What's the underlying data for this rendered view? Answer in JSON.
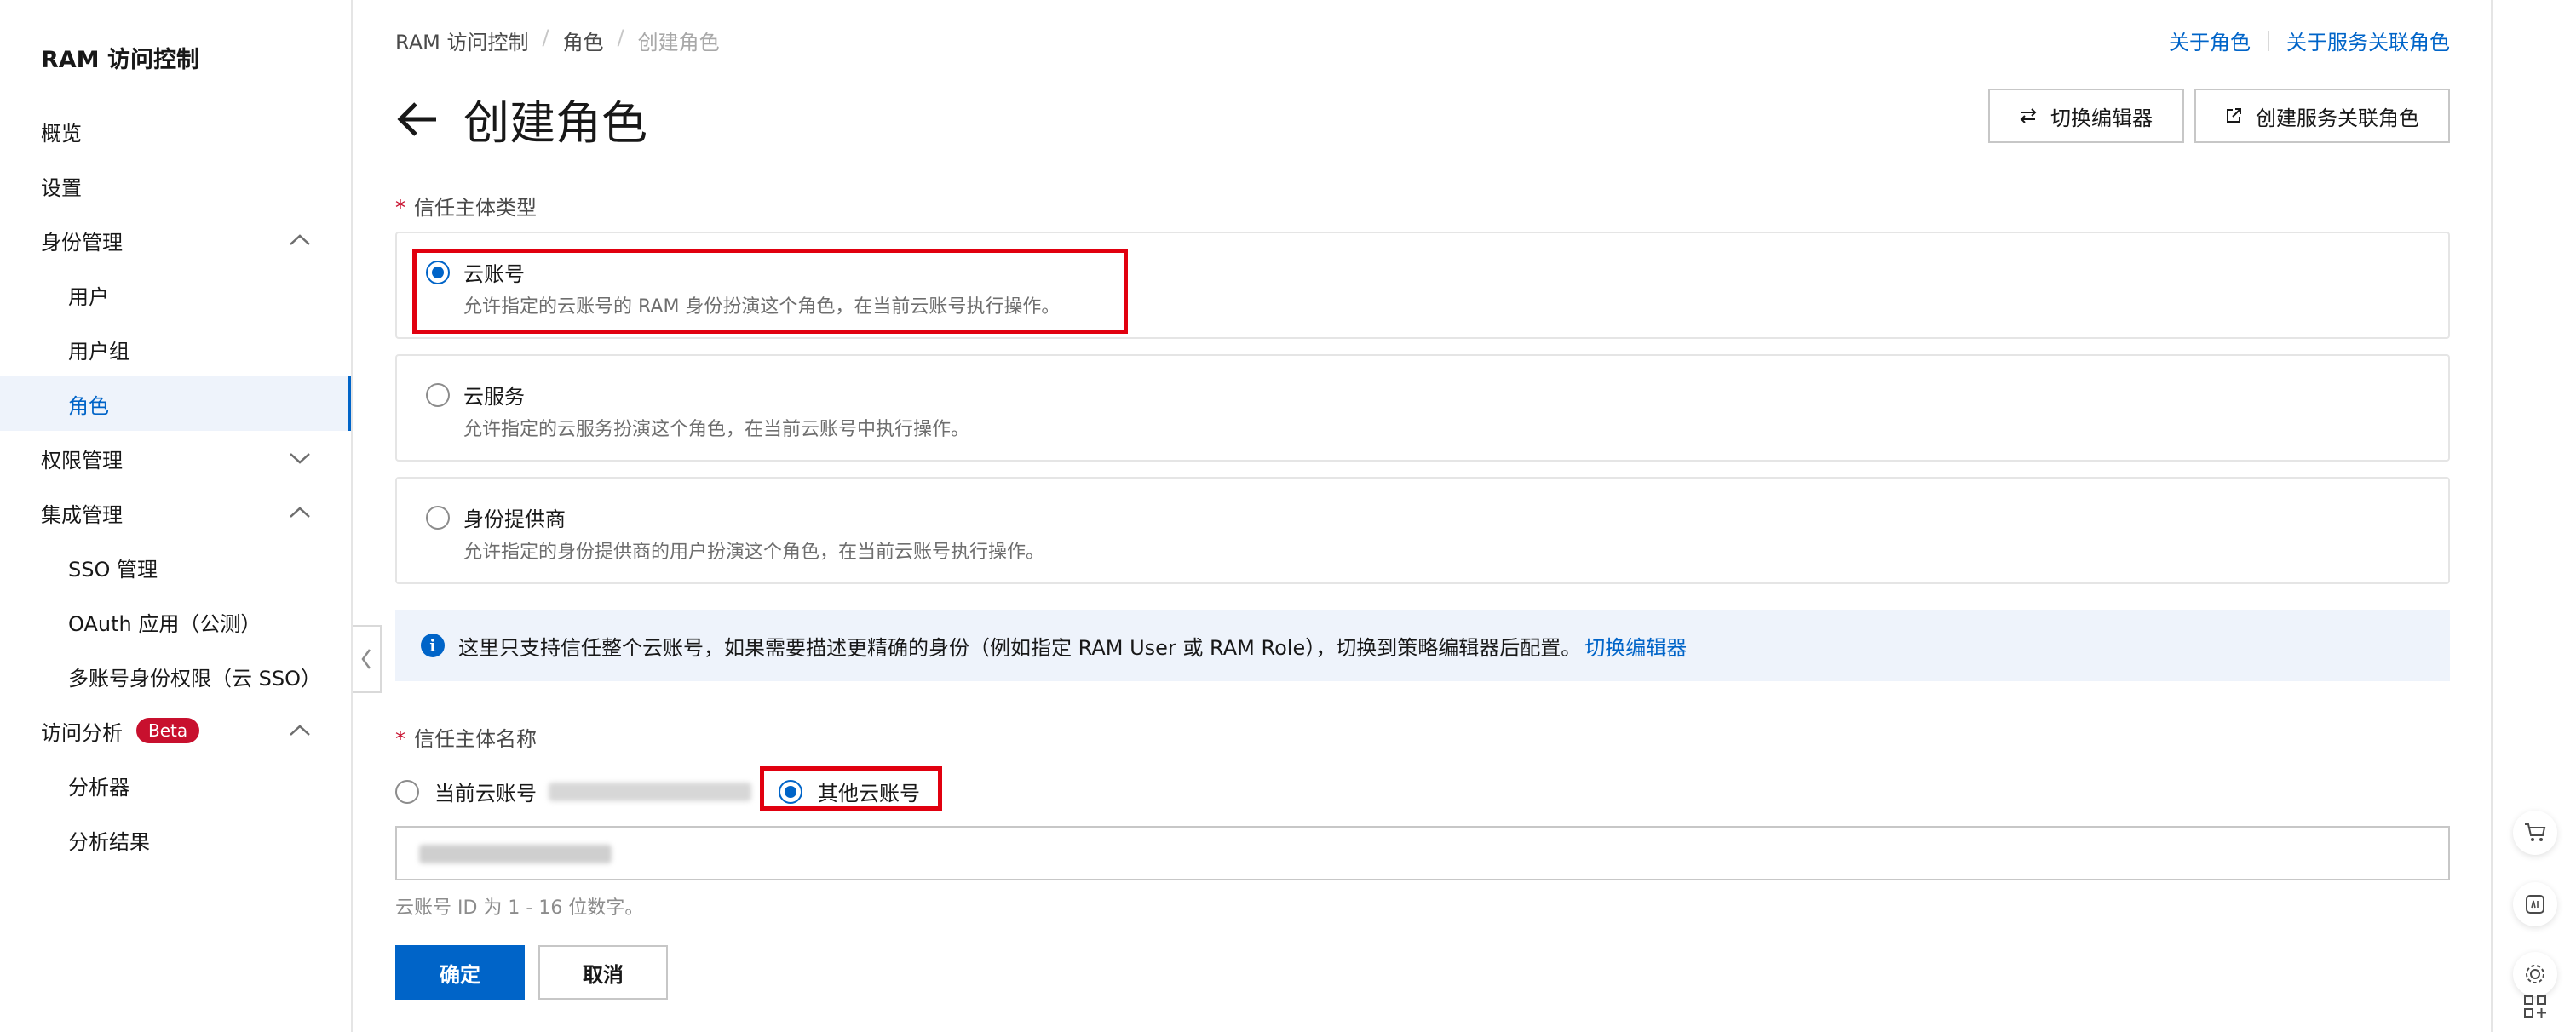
{
  "sidebar": {
    "title": "RAM 访问控制",
    "items": [
      {
        "label": "概览"
      },
      {
        "label": "设置"
      },
      {
        "label": "身份管理"
      },
      {
        "label": "用户"
      },
      {
        "label": "用户组"
      },
      {
        "label": "角色"
      },
      {
        "label": "权限管理"
      },
      {
        "label": "集成管理"
      },
      {
        "label": "SSO 管理"
      },
      {
        "label": "OAuth 应用（公测）"
      },
      {
        "label": "多账号身份权限（云 SSO）"
      },
      {
        "label": "访问分析",
        "badge": "Beta"
      },
      {
        "label": "分析器"
      },
      {
        "label": "分析结果"
      }
    ]
  },
  "breadcrumb": [
    "RAM 访问控制",
    "角色",
    "创建角色"
  ],
  "breadcrumb_sep": "/",
  "top_links": {
    "about_role": "关于角色",
    "about_service_role": "关于服务关联角色"
  },
  "page_title": "创建角色",
  "buttons": {
    "switch_editor": "切换编辑器",
    "create_service_role": "创建服务关联角色",
    "confirm": "确定",
    "cancel": "取消"
  },
  "trust_type": {
    "label": "信任主体类型",
    "required_mark": "*",
    "options": [
      {
        "title": "云账号",
        "desc": "允许指定的云账号的 RAM 身份扮演这个角色，在当前云账号执行操作。",
        "selected": true
      },
      {
        "title": "云服务",
        "desc": "允许指定的云服务扮演这个角色，在当前云账号中执行操作。",
        "selected": false
      },
      {
        "title": "身份提供商",
        "desc": "允许指定的身份提供商的用户扮演这个角色，在当前云账号执行操作。",
        "selected": false
      }
    ]
  },
  "info": {
    "text": "这里只支持信任整个云账号，如果需要描述更精确的身份（例如指定 RAM User 或 RAM Role），切换到策略编辑器后配置。",
    "link": "切换编辑器"
  },
  "trust_name": {
    "label": "信任主体名称",
    "required_mark": "*",
    "current_account": "当前云账号",
    "other_account": "其他云账号",
    "other_selected": true,
    "hint": "云账号 ID 为 1 - 16 位数字。"
  },
  "colors": {
    "primary": "#0064c8",
    "highlight": "#e1000f",
    "required": "#c8102e"
  },
  "icons": [
    "back-arrow-icon",
    "swap-icon",
    "external-link-icon",
    "info-icon",
    "chevron-up-icon",
    "chevron-down-icon",
    "chevron-left-icon",
    "cart-icon",
    "api-icon",
    "settings-icon",
    "apps-grid-icon"
  ]
}
